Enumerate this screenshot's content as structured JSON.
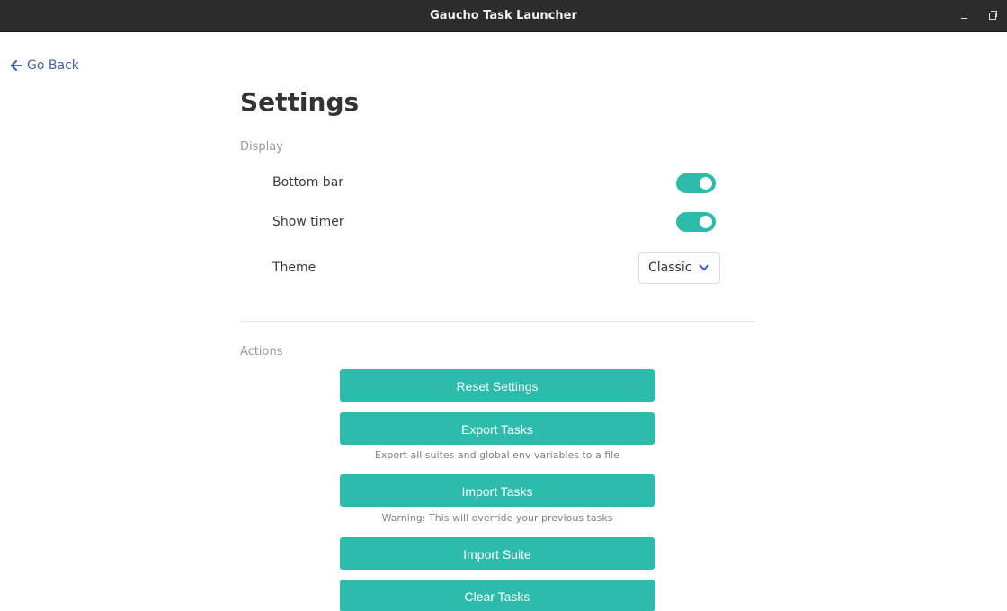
{
  "window": {
    "title": "Gaucho Task Launcher",
    "minimize_label": "–"
  },
  "nav": {
    "go_back": "Go Back"
  },
  "page": {
    "title": "Settings"
  },
  "display": {
    "section_label": "Display",
    "bottom_bar": {
      "label": "Bottom bar",
      "enabled": true
    },
    "show_timer": {
      "label": "Show timer",
      "enabled": true
    },
    "theme": {
      "label": "Theme",
      "value": "Classic"
    }
  },
  "actions": {
    "section_label": "Actions",
    "reset_settings": "Reset Settings",
    "export_tasks": "Export Tasks",
    "export_hint": "Export all suites and global env variables to a file",
    "import_tasks": "Import Tasks",
    "import_hint": "Warning: This will override your previous tasks",
    "import_suite": "Import Suite",
    "clear_tasks": "Clear Tasks"
  },
  "colors": {
    "accent": "#2dbbab",
    "link": "#3e5ec8",
    "titlebar": "#2c2c2c"
  }
}
